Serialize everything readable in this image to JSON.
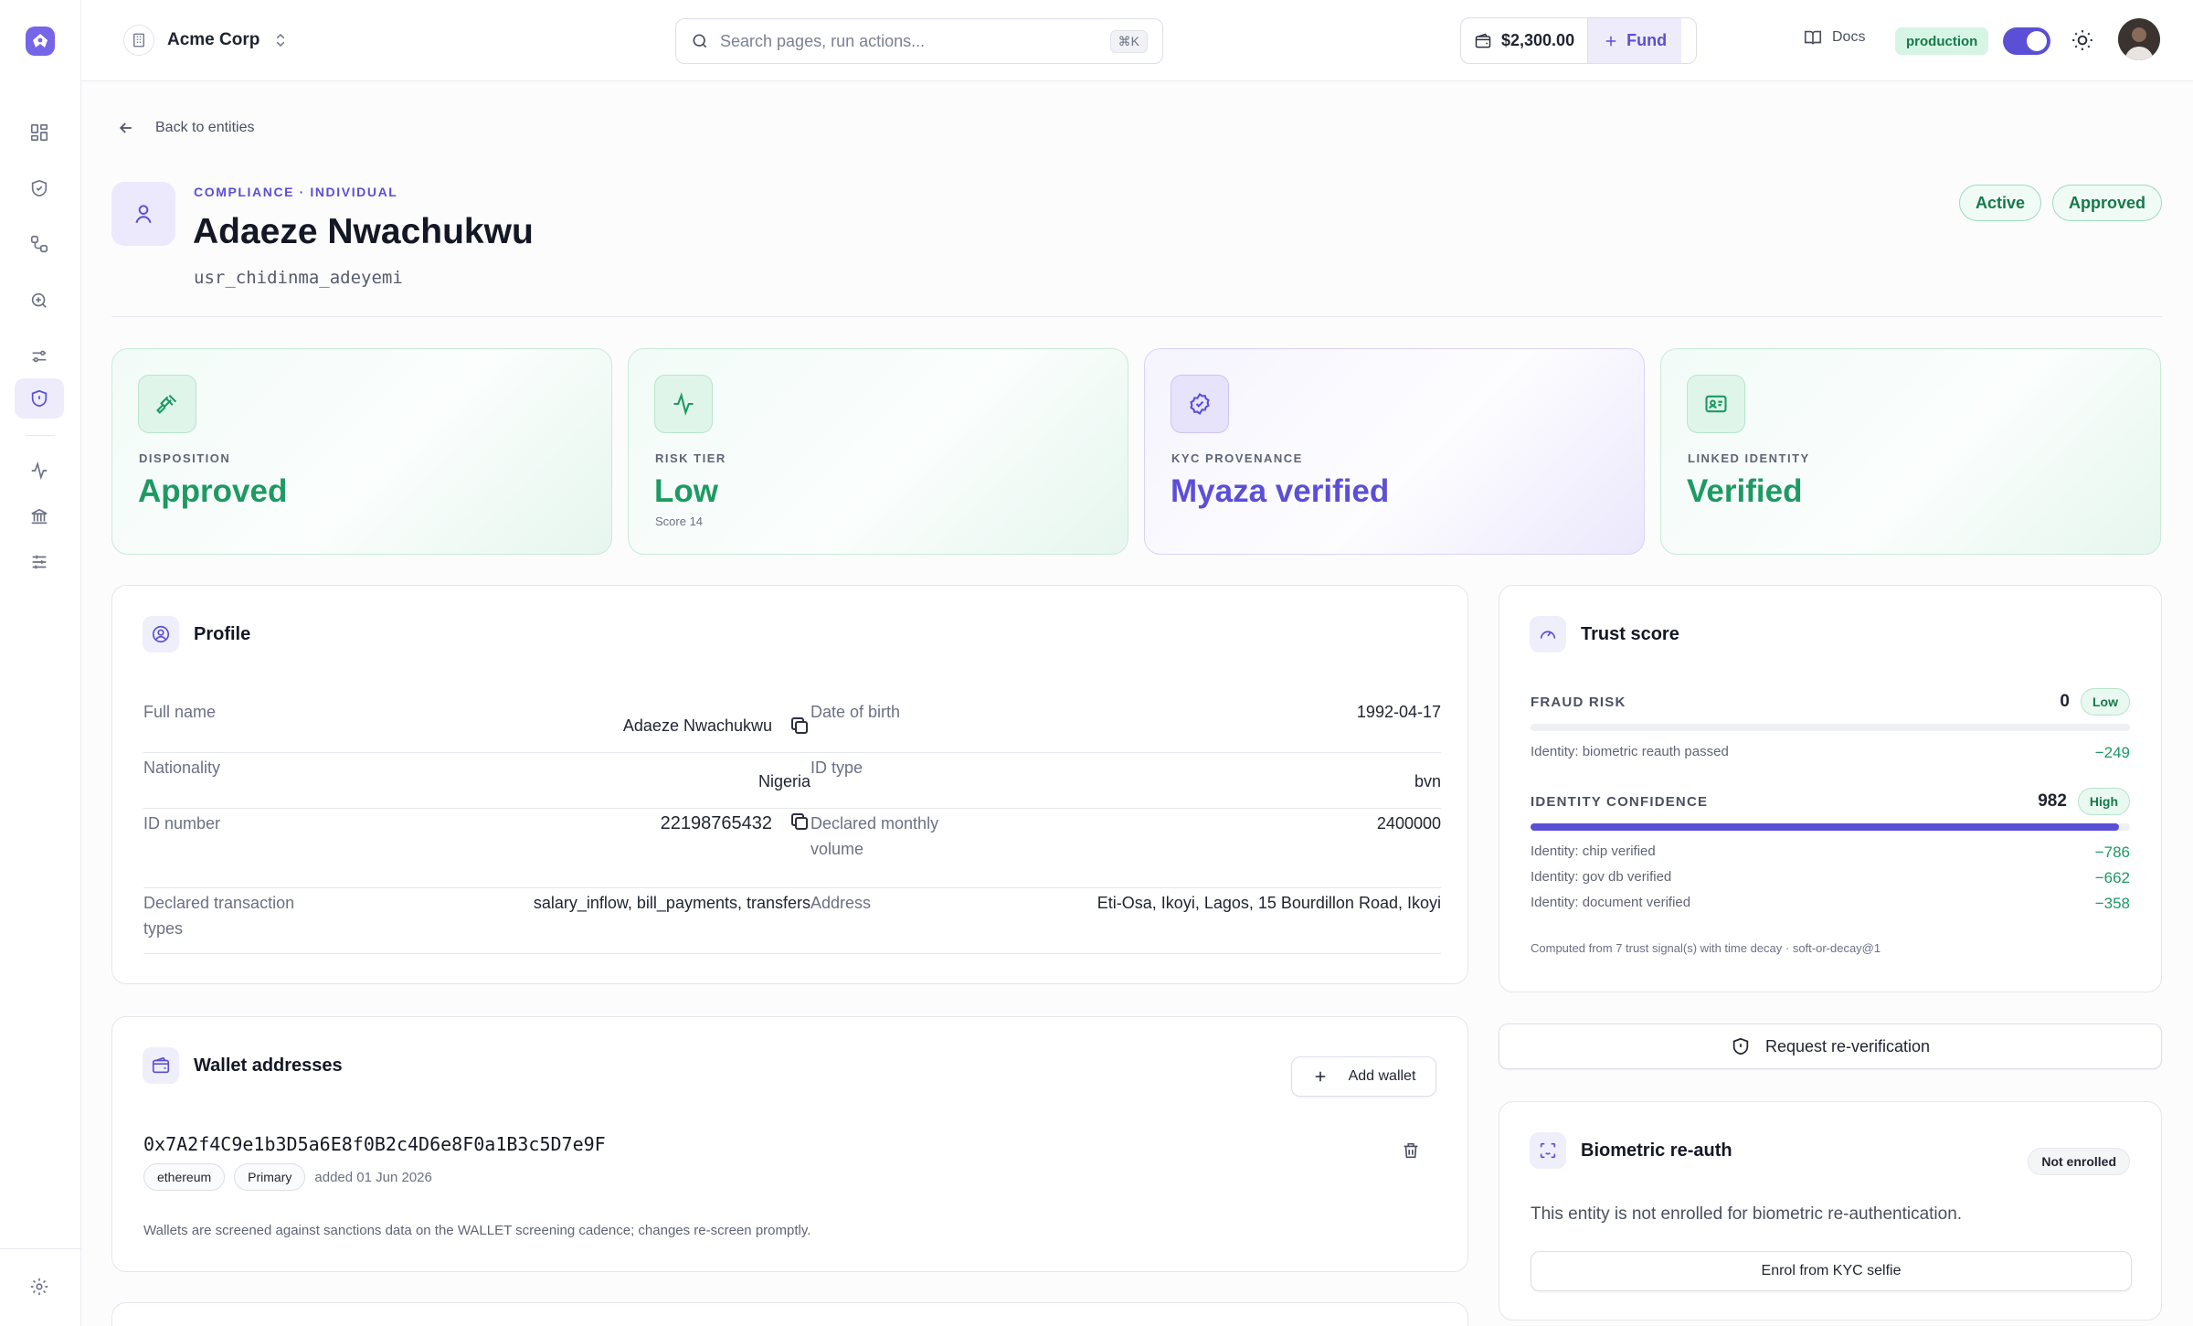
{
  "org": {
    "name": "Acme Corp"
  },
  "search": {
    "placeholder": "Search pages, run actions...",
    "shortcut": "⌘K"
  },
  "balance": {
    "amount": "$2,300.00",
    "fund_label": "Fund"
  },
  "docs_label": "Docs",
  "environment": {
    "label": "production",
    "toggle_on": true
  },
  "sidebar": {
    "items": [
      {
        "name": "dashboard",
        "icon": "grid-icon"
      },
      {
        "name": "compliance",
        "icon": "shield-check-icon"
      },
      {
        "name": "flows",
        "icon": "workflow-icon"
      },
      {
        "name": "investigations",
        "icon": "search-zoom-icon"
      },
      {
        "name": "rules",
        "icon": "sliders-icon"
      },
      {
        "name": "entities",
        "icon": "shield-icon",
        "active": true
      },
      {
        "name": "activity",
        "icon": "activity-icon"
      },
      {
        "name": "banking",
        "icon": "bank-icon"
      },
      {
        "name": "controls",
        "icon": "filters-icon"
      },
      {
        "name": "settings",
        "icon": "gear-icon"
      }
    ]
  },
  "back_label": "Back to entities",
  "entity": {
    "eyebrow": "COMPLIANCE · INDIVIDUAL",
    "name": "Adaeze Nwachukwu",
    "id": "usr_chidinma_adeyemi",
    "badges": [
      "Active",
      "Approved"
    ]
  },
  "stats": [
    {
      "label": "DISPOSITION",
      "value": "Approved",
      "sub": "",
      "icon": "gavel-icon",
      "tone": "green"
    },
    {
      "label": "RISK TIER",
      "value": "Low",
      "sub": "Score 14",
      "icon": "activity-icon",
      "tone": "green"
    },
    {
      "label": "KYC PROVENANCE",
      "value": "Myaza verified",
      "sub": "",
      "icon": "badge-check-icon",
      "tone": "purple"
    },
    {
      "label": "LINKED IDENTITY",
      "value": "Verified",
      "sub": "",
      "icon": "id-card-icon",
      "tone": "green"
    }
  ],
  "profile": {
    "title": "Profile",
    "left": [
      {
        "label": "Full name",
        "value": "Adaeze Nwachukwu",
        "copy": true
      },
      {
        "label": "Nationality",
        "value": "Nigeria"
      },
      {
        "label": "ID number",
        "value": "22198765432",
        "copy": true
      },
      {
        "label": "Declared transaction types",
        "value": "salary_inflow, bill_payments, transfers"
      }
    ],
    "right": [
      {
        "label": "Date of birth",
        "value": "1992-04-17"
      },
      {
        "label": "ID type",
        "value": "bvn"
      },
      {
        "label": "Declared monthly volume",
        "value": "2400000"
      },
      {
        "label": "Address",
        "value": "Eti-Osa, Ikoyi, Lagos, 15 Bourdillon Road, Ikoyi"
      }
    ]
  },
  "trust": {
    "title": "Trust score",
    "fraud": {
      "label": "FRAUD RISK",
      "score": "0",
      "level": "Low",
      "fill": 0
    },
    "fraud_signals": [
      {
        "label": "Identity: biometric reauth passed",
        "delta": "−249"
      }
    ],
    "confidence": {
      "label": "IDENTITY CONFIDENCE",
      "score": "982",
      "level": "High",
      "fill": 0.982
    },
    "confidence_signals": [
      {
        "label": "Identity: chip verified",
        "delta": "−786"
      },
      {
        "label": "Identity: gov db verified",
        "delta": "−662"
      },
      {
        "label": "Identity: document verified",
        "delta": "−358"
      }
    ],
    "footnote": "Computed from 7 trust signal(s) with time decay · soft-or-decay@1"
  },
  "reverify_label": "Request re-verification",
  "wallets": {
    "title": "Wallet addresses",
    "add_label": "Add wallet",
    "items": [
      {
        "address": "0x7A2f4C9e1b3D5a6E8f0B2c4D6e8F0a1B3c5D7e9F",
        "chain": "ethereum",
        "tag": "Primary",
        "added": "added 01 Jun 2026"
      }
    ],
    "note": "Wallets are screened against sanctions data on the WALLET screening cadence; changes re-screen promptly."
  },
  "biometric": {
    "title": "Biometric re-auth",
    "status": "Not enrolled",
    "message": "This entity is not enrolled for biometric re-authentication.",
    "enrol_label": "Enrol from KYC selfie"
  }
}
